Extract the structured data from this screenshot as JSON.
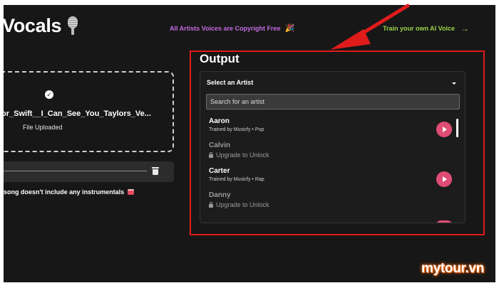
{
  "header": {
    "title": "Vocals",
    "title_emoji": "microphone-icon",
    "notice": "All Artists Voices are Copyright Free",
    "notice_emoji": "🎉",
    "train_link": "Train your own AI Voice",
    "train_arrow": "→"
  },
  "upload": {
    "file_name": "or_Swift__I_Can_See_You_Taylors_Ve...",
    "status": "File Uploaded",
    "warning": "song doesn't include any instrumentals"
  },
  "output": {
    "title": "Output",
    "select_label": "Select an Artist",
    "search_placeholder": "Search for an artist",
    "artists": [
      {
        "name": "Aaron",
        "subtitle": "Trained by Musicfy • Pop",
        "locked": false
      },
      {
        "name": "Calvin",
        "subtitle": "Upgrade to Unlock",
        "locked": true
      },
      {
        "name": "Carter",
        "subtitle": "Trained by Musicfy • Rap",
        "locked": false
      },
      {
        "name": "Danny",
        "subtitle": "Upgrade to Unlock",
        "locked": true
      }
    ]
  },
  "colors": {
    "background": "#171717",
    "accent_purple": "#c46be0",
    "accent_green": "#9ad24b",
    "play_button": "#df4c74",
    "highlight_frame": "#e01b1b"
  },
  "watermark": "mytour.vn"
}
